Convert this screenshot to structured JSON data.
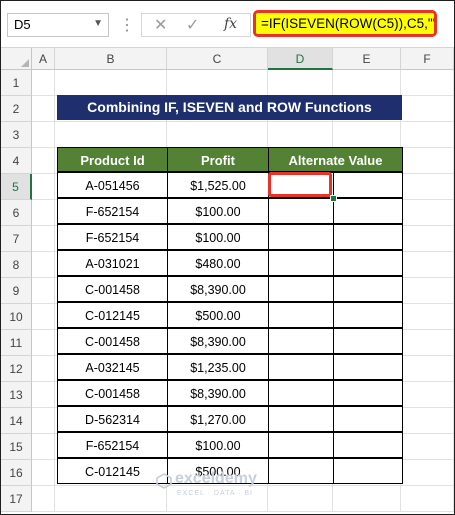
{
  "formula_bar": {
    "name_box": "D5",
    "dropdown_icon": "chevron-down-icon",
    "dots": "⋮",
    "cancel_glyph": "✕",
    "enter_glyph": "✓",
    "fx_label": "fx",
    "formula": "=IF(ISEVEN(ROW(C5)),C5,\"\")"
  },
  "columns": [
    "A",
    "B",
    "C",
    "D",
    "E",
    "F"
  ],
  "active_column": "D",
  "rows": [
    "1",
    "2",
    "3",
    "4",
    "5",
    "6",
    "7",
    "8",
    "9",
    "10",
    "11",
    "12",
    "13",
    "14",
    "15",
    "16",
    "17"
  ],
  "active_row": "5",
  "title": "Combining IF, ISEVEN and ROW Functions",
  "table": {
    "headers": [
      "Product Id",
      "Profit",
      "Alternate Value"
    ],
    "rows": [
      [
        "A-051456",
        "$1,525.00",
        ""
      ],
      [
        "F-652154",
        "$100.00",
        ""
      ],
      [
        "F-652154",
        "$100.00",
        ""
      ],
      [
        "A-031021",
        "$480.00",
        ""
      ],
      [
        "C-001458",
        "$8,390.00",
        ""
      ],
      [
        "C-012145",
        "$500.00",
        ""
      ],
      [
        "C-001458",
        "$8,390.00",
        ""
      ],
      [
        "A-032145",
        "$1,235.00",
        ""
      ],
      [
        "C-001458",
        "$8,390.00",
        ""
      ],
      [
        "D-562314",
        "$1,270.00",
        ""
      ],
      [
        "F-652154",
        "$100.00",
        ""
      ],
      [
        "C-012145",
        "$500.00",
        ""
      ]
    ]
  },
  "watermark": {
    "name": "exceldemy",
    "tagline": "EXCEL · DATA · BI"
  },
  "colors": {
    "title_bg": "#1f2f6e",
    "header_bg": "#548235",
    "highlight_border": "#e8322a",
    "formula_bg": "#ffff00"
  }
}
